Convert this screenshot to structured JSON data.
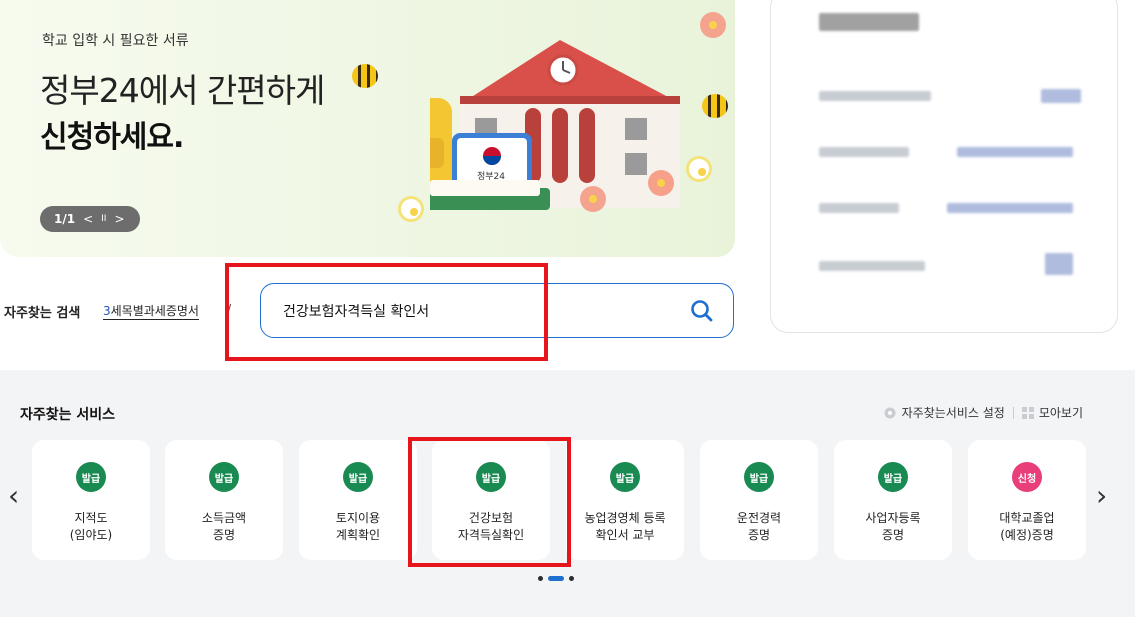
{
  "banner": {
    "subtitle": "학교 입학 시 필요한 서류",
    "headline_line1": "정부24에서 간편하게",
    "headline_line2": "신청하세요.",
    "pager": "1/1",
    "prev": "<",
    "pause": "II",
    "next": ">",
    "emblem_text": "정부24"
  },
  "search": {
    "label": "자주찾는 검색",
    "keyword_num": "3",
    "keyword_text": "세목별과세증명서",
    "chevron": "∨",
    "value": "건강보험자격득실 확인서"
  },
  "services": {
    "title": "자주찾는 서비스",
    "settings_label": "자주찾는서비스 설정",
    "view_all_label": "모아보기",
    "prev_arrow": "‹",
    "next_arrow": "›",
    "cards": [
      {
        "badge": "발급",
        "badge_color": "#1a8a53",
        "label": "지적도\n(임야도)"
      },
      {
        "badge": "발급",
        "badge_color": "#1a8a53",
        "label": "소득금액\n증명"
      },
      {
        "badge": "발급",
        "badge_color": "#1a8a53",
        "label": "토지이용\n계획확인"
      },
      {
        "badge": "발급",
        "badge_color": "#1a8a53",
        "label": "건강보험\n자격득실확인"
      },
      {
        "badge": "발급",
        "badge_color": "#1a8a53",
        "label": "농업경영체 등록\n확인서 교부"
      },
      {
        "badge": "발급",
        "badge_color": "#1a8a53",
        "label": "운전경력\n증명"
      },
      {
        "badge": "발급",
        "badge_color": "#1a8a53",
        "label": "사업자등록\n증명"
      },
      {
        "badge": "신청",
        "badge_color": "#e83f7b",
        "label": "대학교졸업\n(예정)증명"
      }
    ]
  },
  "colors": {
    "accent": "#1f6fd1",
    "highlight": "#e8141b",
    "issue_green": "#1a8a53",
    "apply_pink": "#e83f7b"
  }
}
